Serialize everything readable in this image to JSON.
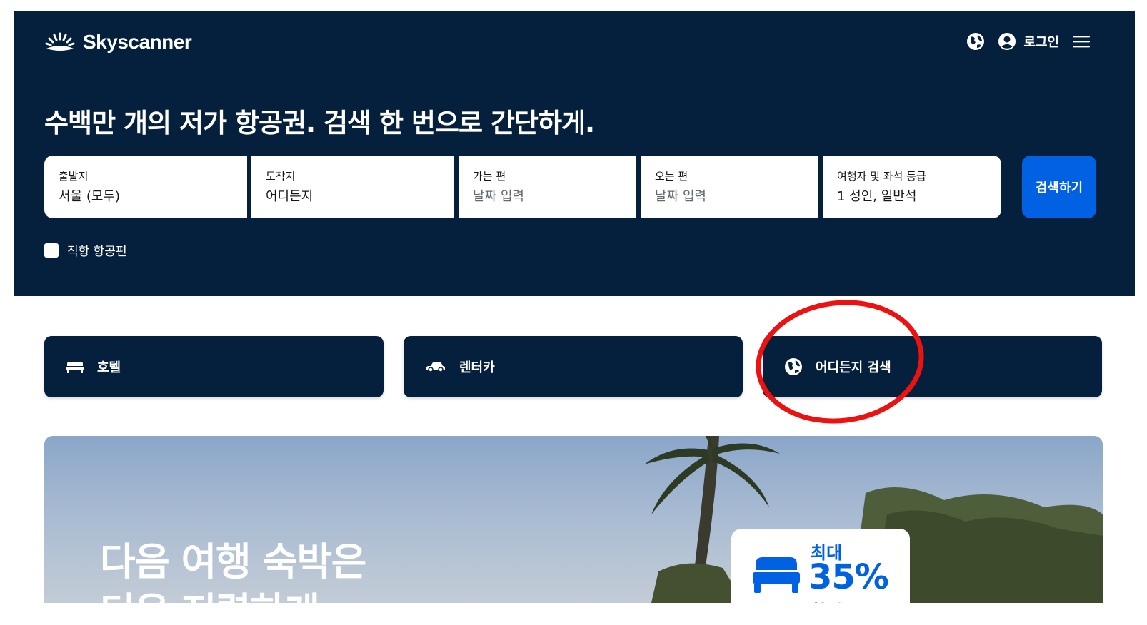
{
  "header": {
    "brand": "Skyscanner",
    "login_label": "로그인",
    "headline": "수백만 개의 저가 항공권. 검색 한 번으로 간단하게."
  },
  "search": {
    "fields": [
      {
        "label": "출발지",
        "value": "서울 (모두)",
        "placeholder": false
      },
      {
        "label": "도착지",
        "value": "어디든지",
        "placeholder": false
      },
      {
        "label": "가는 편",
        "value": "날짜 입력",
        "placeholder": true
      },
      {
        "label": "오는 편",
        "value": "날짜 입력",
        "placeholder": true
      },
      {
        "label": "여행자 및 좌석 등급",
        "value": "1 성인, 일반석",
        "placeholder": false
      }
    ],
    "button_label": "검색하기",
    "direct_label": "직항 항공편",
    "direct_checked": false
  },
  "tiles": [
    {
      "label": "호텔",
      "icon": "bed-icon"
    },
    {
      "label": "렌터카",
      "icon": "car-icon"
    },
    {
      "label": "어디든지 검색",
      "icon": "globe-icon"
    }
  ],
  "banner": {
    "title_line1": "다음 여행 숙박은",
    "title_line2": "더욱 저렴하게",
    "promo_top": "최대",
    "promo_value": "35%",
    "promo_bottom": "할인"
  },
  "colors": {
    "hero_bg": "#05203c",
    "accent": "#0062e3",
    "annotation": "#ee1111"
  }
}
